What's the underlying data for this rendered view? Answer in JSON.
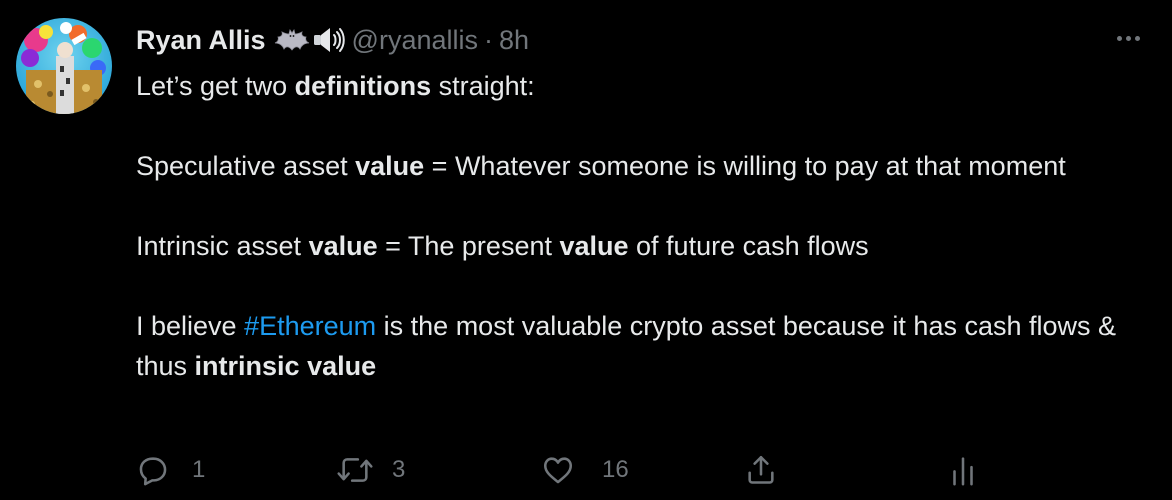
{
  "tweet": {
    "author": {
      "display_name": "Ryan Allis",
      "name_emojis": [
        "bat-emoji",
        "speaker-emoji"
      ],
      "handle": "@ryanallis",
      "separator": "·",
      "time": "8h"
    },
    "menu_icon": "more-horizontal-icon",
    "body": {
      "line1": {
        "pre": "Let’s get two ",
        "bold": "definitions",
        "post": " straight:"
      },
      "line2": {
        "pre": "Speculative asset ",
        "bold": "value",
        "post": " = Whatever someone is willing to pay at that moment"
      },
      "line3": {
        "pre": "Intrinsic asset ",
        "bold1": "value",
        "mid": " = The present ",
        "bold2": "value",
        "post": " of future cash flows"
      },
      "line4": {
        "pre": "I believe ",
        "hashtag": "#Ethereum",
        "mid": " is the most valuable crypto asset because it has cash flows & thus ",
        "bold": "intrinsic value"
      }
    },
    "colors": {
      "background": "#000000",
      "text": "#e7e9ea",
      "muted": "#71767b",
      "link": "#1d9bf0"
    },
    "actions": {
      "reply": {
        "icon": "reply-icon",
        "count": "1"
      },
      "retweet": {
        "icon": "retweet-icon",
        "count": "3"
      },
      "like": {
        "icon": "heart-icon",
        "count": "16"
      },
      "share": {
        "icon": "share-icon"
      },
      "analytics": {
        "icon": "analytics-icon"
      }
    }
  }
}
